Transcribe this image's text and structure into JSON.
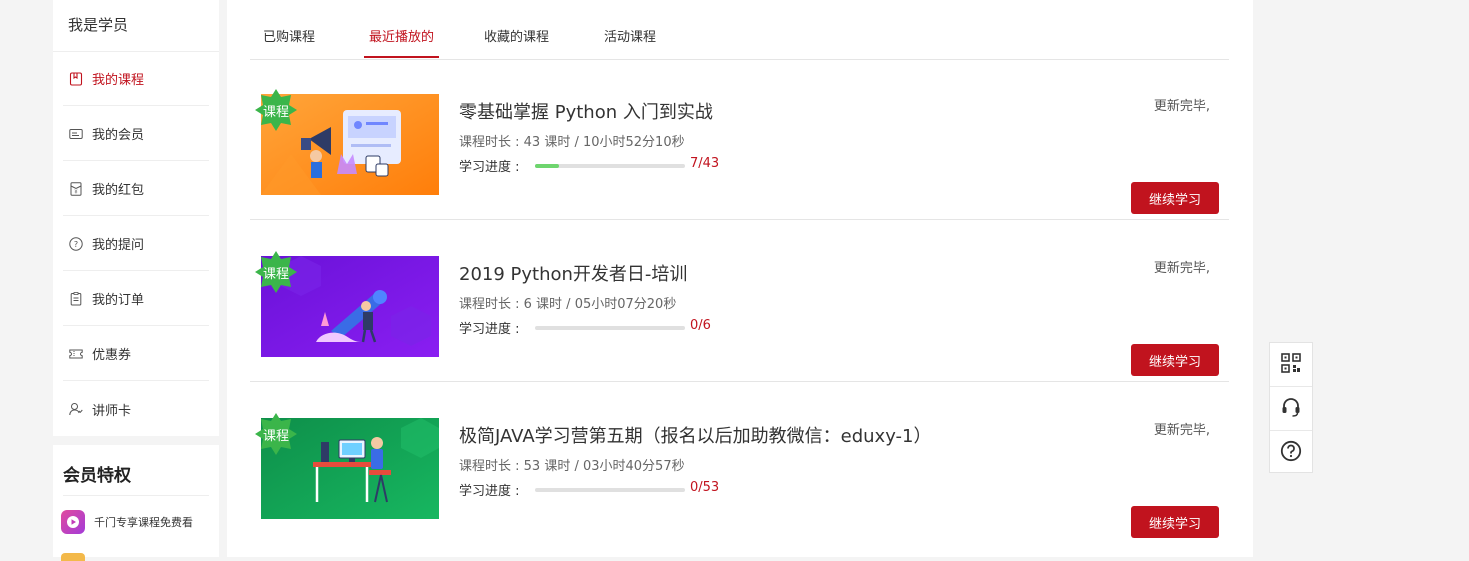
{
  "sidebar": {
    "title": "我是学员",
    "items": [
      {
        "label": "我的课程",
        "icon": "bookmark-icon",
        "active": true
      },
      {
        "label": "我的会员",
        "icon": "member-card-icon",
        "active": false
      },
      {
        "label": "我的红包",
        "icon": "red-packet-icon",
        "active": false
      },
      {
        "label": "我的提问",
        "icon": "question-icon",
        "active": false
      },
      {
        "label": "我的订单",
        "icon": "order-icon",
        "active": false
      },
      {
        "label": "优惠券",
        "icon": "coupon-icon",
        "active": false
      },
      {
        "label": "讲师卡",
        "icon": "lecturer-icon",
        "active": false
      }
    ],
    "vip": {
      "title": "会员特权",
      "item": "千门专享课程免费看"
    }
  },
  "tabs": [
    {
      "label": "已购课程",
      "active": false
    },
    {
      "label": "最近播放的",
      "active": true
    },
    {
      "label": "收藏的课程",
      "active": false
    },
    {
      "label": "活动课程",
      "active": false
    }
  ],
  "courses": [
    {
      "tag": "课程",
      "title": "零基础掌握 Python 入门到实战",
      "meta": "课程时长 : 43 课时 / 10小时52分10秒",
      "progress_label": "学习进度 :",
      "progress": 0.163,
      "count": "7/43",
      "status": "更新完毕,",
      "button": "继续学习",
      "theme": "orange"
    },
    {
      "tag": "课程",
      "title": "2019 Python开发者日-培训",
      "meta": "课程时长 : 6 课时 / 05小时07分20秒",
      "progress_label": "学习进度 :",
      "progress": 0,
      "count": "0/6",
      "status": "更新完毕,",
      "button": "继续学习",
      "theme": "purple"
    },
    {
      "tag": "课程",
      "title": "极简JAVA学习营第五期（报名以后加助教微信：eduxy-1）",
      "meta": "课程时长 : 53 课时 / 03小时40分57秒",
      "progress_label": "学习进度 :",
      "progress": 0,
      "count": "0/53",
      "status": "更新完毕,",
      "button": "继续学习",
      "theme": "green"
    }
  ],
  "float_toolbar": [
    {
      "icon": "qrcode-icon"
    },
    {
      "icon": "headset-icon"
    },
    {
      "icon": "help-icon"
    }
  ],
  "colors": {
    "accent": "#c1131e",
    "progress": "#6ed56e",
    "tag": "#3bb54a"
  }
}
